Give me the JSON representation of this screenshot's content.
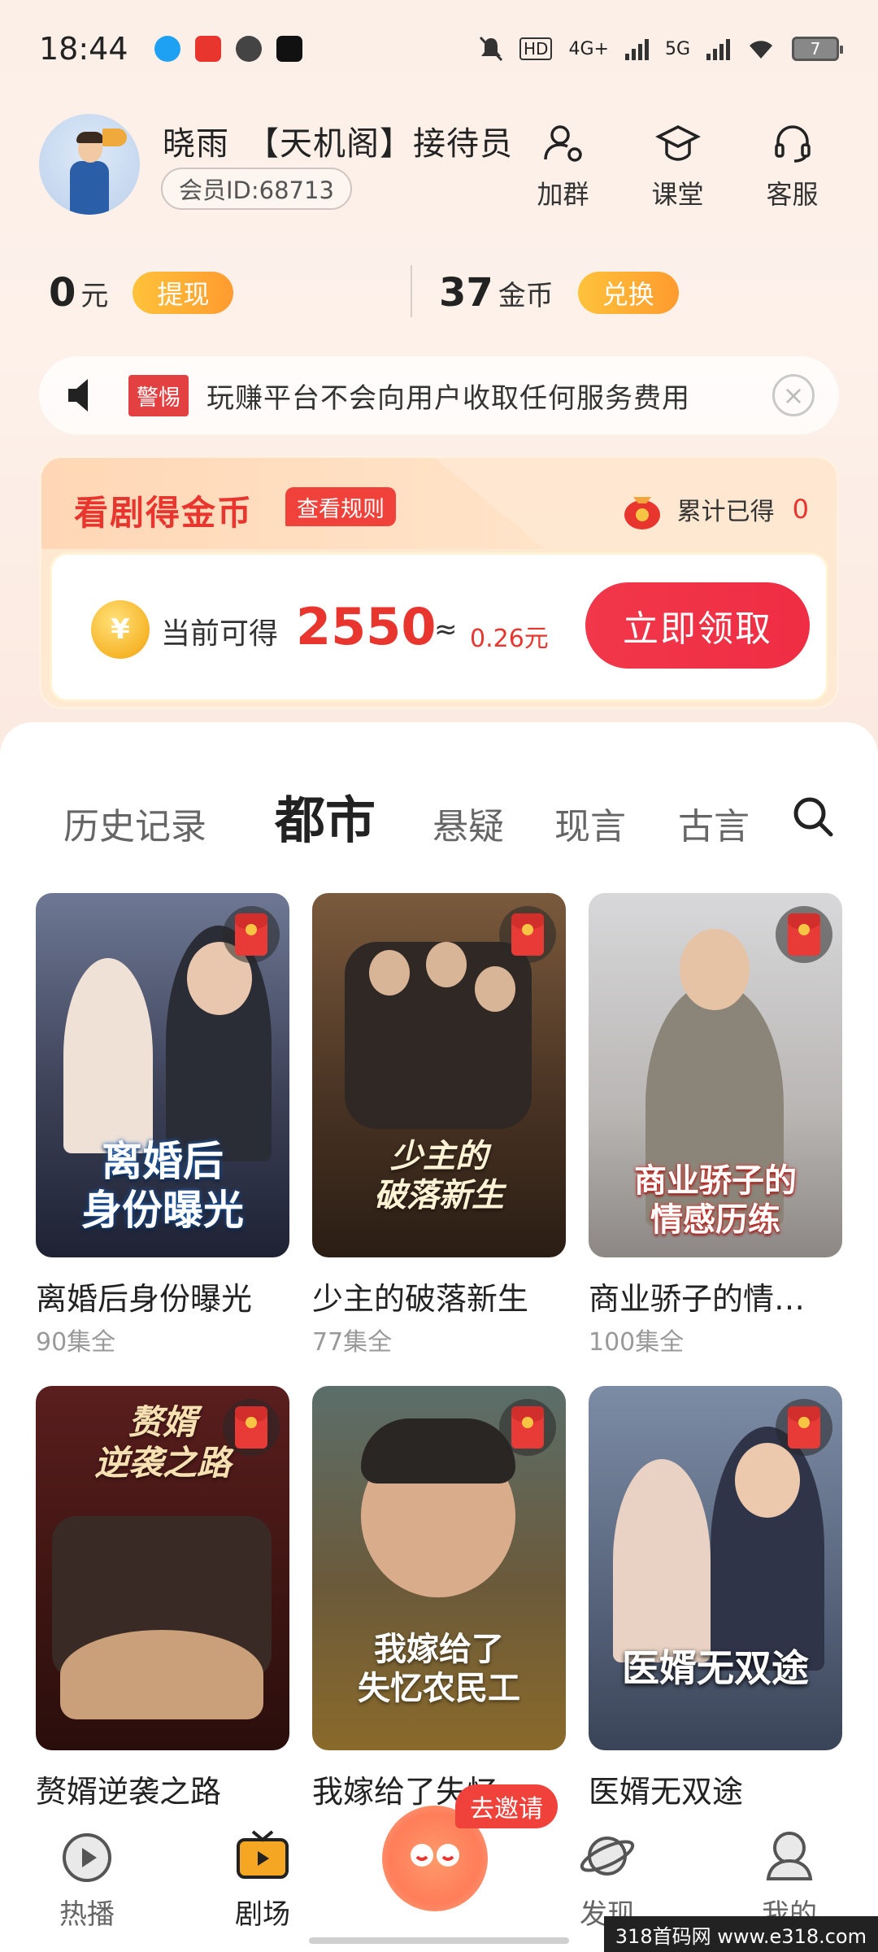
{
  "status_bar": {
    "time": "18:44",
    "hd_label": "HD",
    "net_4g": "4G+",
    "net_5g": "5G",
    "battery": "7"
  },
  "profile": {
    "name": "晓雨　【天机阁】接待员",
    "member_id": "会员ID:68713",
    "actions": [
      {
        "label": "加群",
        "icon": "user-group-icon"
      },
      {
        "label": "课堂",
        "icon": "graduation-cap-icon"
      },
      {
        "label": "客服",
        "icon": "headset-icon"
      }
    ]
  },
  "balance": {
    "cash_value": "0",
    "cash_unit": "元",
    "withdraw_label": "提现",
    "coins_value": "37",
    "coins_unit": "金币",
    "exchange_label": "兑换"
  },
  "notice": {
    "tag": "警惕",
    "text": "玩赚平台不会向用户收取任何服务费用",
    "close_glyph": "×"
  },
  "reward": {
    "title": "看剧得金币",
    "rules_label": "查看规则",
    "accumulated_label": "累计已得",
    "accumulated_value": "0",
    "coin_glyph": "¥",
    "current_label": "当前可得",
    "current_value": "2550",
    "approx": "≈",
    "current_yuan": "0.26元",
    "claim_label": "立即领取"
  },
  "tabs": {
    "items": [
      "历史记录",
      "都市",
      "悬疑",
      "现言",
      "古言"
    ],
    "active": "都市"
  },
  "dramas": [
    {
      "title": "离婚后身份曝光",
      "episodes": "90集全",
      "art": "离婚后\n身份曝光"
    },
    {
      "title": "少主的破落新生",
      "episodes": "77集全",
      "art": "少主的\n破落新生"
    },
    {
      "title": "商业骄子的情…",
      "episodes": "100集全",
      "art": "商业骄子的\n情感历练"
    },
    {
      "title": "赘婿逆袭之路",
      "episodes": "",
      "art": "赘婿\n逆袭之路"
    },
    {
      "title": "我嫁给了失忆…",
      "episodes": "",
      "art": "我嫁给了\n失忆农民工"
    },
    {
      "title": "医婿无双途",
      "episodes": "",
      "art": "医婿无双途"
    }
  ],
  "bottom_nav": {
    "items": [
      {
        "label": "热播",
        "icon": "play-circle-icon"
      },
      {
        "label": "剧场",
        "icon": "tv-icon"
      },
      {
        "label": "发现",
        "icon": "planet-icon"
      },
      {
        "label": "我的",
        "icon": "profile-icon"
      }
    ],
    "invite_label": "去邀请",
    "active": "剧场"
  },
  "watermark": "318首码网 www.e318.com",
  "colors": {
    "accent_red": "#e8362f",
    "accent_orange": "#ff9b2f",
    "claim_button": "#f2374a"
  }
}
